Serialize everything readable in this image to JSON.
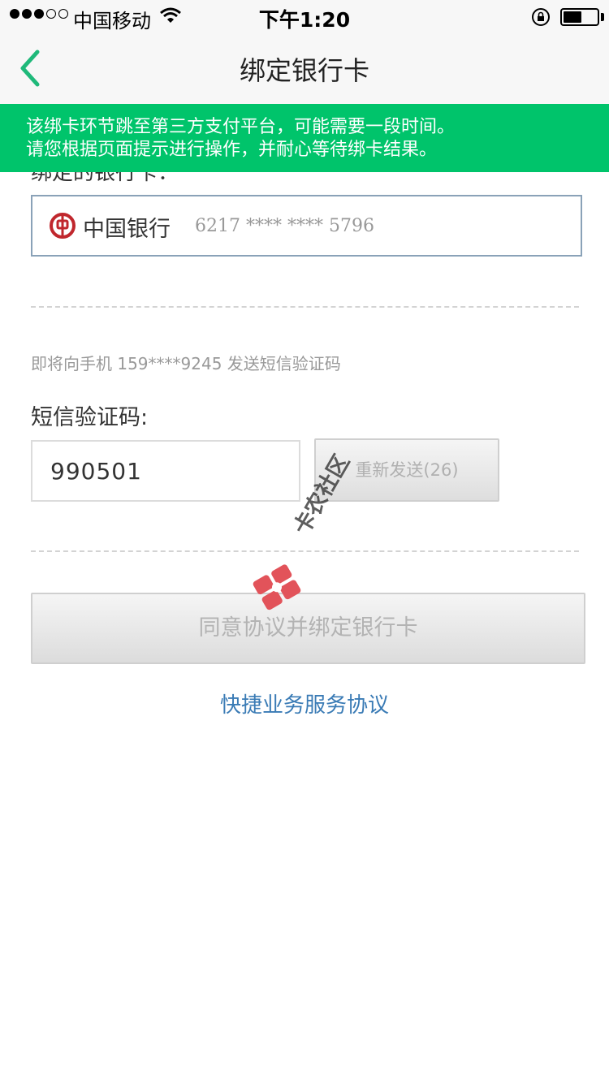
{
  "status_bar": {
    "carrier": "中国移动",
    "time": "下午1:20"
  },
  "nav": {
    "title": "绑定银行卡",
    "back_icon": "chevron-left-icon"
  },
  "notice": {
    "line1": "该绑卡环节跳至第三方支付平台，可能需要一段时间。",
    "line2": "请您根据页面提示进行操作，并耐心等待绑卡结果。"
  },
  "card": {
    "label": "绑定的银行卡：",
    "bank_name": "中国银行",
    "card_number": "6217 **** **** 5796",
    "logo_icon": "bank-of-china-logo"
  },
  "sms": {
    "hint": "即将向手机 159****9245 发送短信验证码",
    "label": "短信验证码:",
    "code_value": "990501",
    "resend_label": "重新发送(26)"
  },
  "actions": {
    "submit_label": "同意协议并绑定银行卡",
    "agreement_link": "快捷业务服务协议"
  },
  "watermark": {
    "text": "卡农社区"
  },
  "colors": {
    "accent_green": "#00c46b",
    "link_blue": "#3a7bb5",
    "card_border": "#8aa2b8"
  }
}
